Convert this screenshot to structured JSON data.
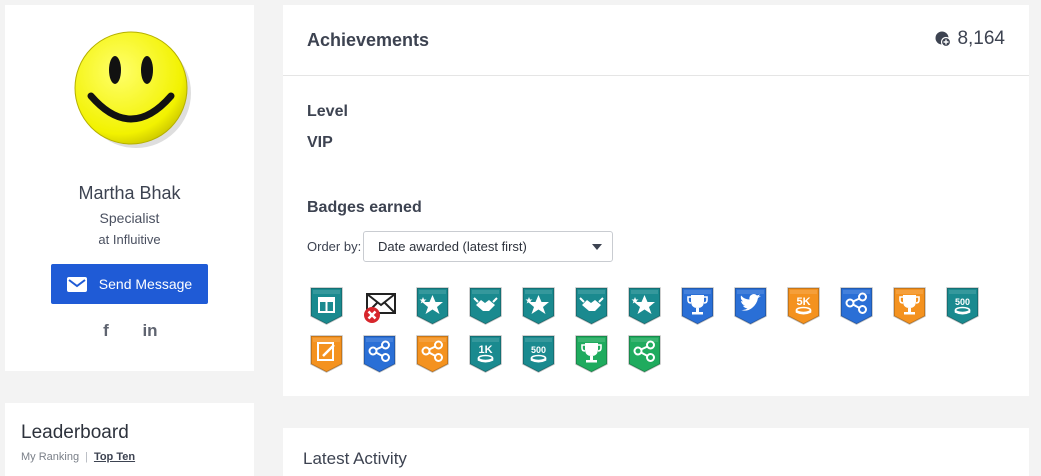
{
  "profile": {
    "name": "Martha Bhak",
    "role": "Specialist",
    "company": "at Influitive",
    "send_message_label": "Send Message",
    "social": [
      "facebook",
      "linkedin"
    ],
    "colors": {
      "button": "#1f5bd6",
      "avatar": "#f5f500"
    }
  },
  "leaderboard": {
    "title": "Leaderboard",
    "tabs": [
      "My Ranking",
      "Top Ten"
    ],
    "active_tab": "Top Ten"
  },
  "achievements": {
    "title": "Achievements",
    "points": "8,164",
    "level_label": "Level",
    "level_value": "VIP",
    "badges_label": "Badges earned",
    "order_label": "Order by:",
    "order_value": "Date awarded (latest first)",
    "badges": [
      {
        "icon": "gift-box-icon",
        "color": "#1a8a8f",
        "text": ""
      },
      {
        "icon": "envelope-declined-icon",
        "color": "none",
        "text": ""
      },
      {
        "icon": "stars-icon",
        "color": "#1a8a8f",
        "text": ""
      },
      {
        "icon": "handshake-icon",
        "color": "#1a8a8f",
        "text": ""
      },
      {
        "icon": "stars-icon",
        "color": "#1a8a8f",
        "text": ""
      },
      {
        "icon": "handshake-icon",
        "color": "#1a8a8f",
        "text": ""
      },
      {
        "icon": "stars-icon",
        "color": "#1a8a8f",
        "text": ""
      },
      {
        "icon": "trophy-icon",
        "color": "#2a6fd6",
        "text": ""
      },
      {
        "icon": "twitter-icon",
        "color": "#2a6fd6",
        "text": ""
      },
      {
        "icon": "coins-icon",
        "color": "#f4921f",
        "text": "5K"
      },
      {
        "icon": "share-icon",
        "color": "#2a6fd6",
        "text": ""
      },
      {
        "icon": "trophy-icon",
        "color": "#f4921f",
        "text": ""
      },
      {
        "icon": "coins-icon",
        "color": "#1a8a8f",
        "text": "500"
      },
      {
        "icon": "edit-icon",
        "color": "#f4921f",
        "text": ""
      },
      {
        "icon": "share-icon",
        "color": "#2a6fd6",
        "text": ""
      },
      {
        "icon": "share-icon",
        "color": "#f4921f",
        "text": ""
      },
      {
        "icon": "coins-icon",
        "color": "#1a8a8f",
        "text": "1K"
      },
      {
        "icon": "coins-icon",
        "color": "#1a8a8f",
        "text": "500"
      },
      {
        "icon": "trophy-icon",
        "color": "#1fab5e",
        "text": ""
      },
      {
        "icon": "share-icon",
        "color": "#1fab5e",
        "text": ""
      }
    ]
  },
  "activity": {
    "title": "Latest Activity"
  }
}
